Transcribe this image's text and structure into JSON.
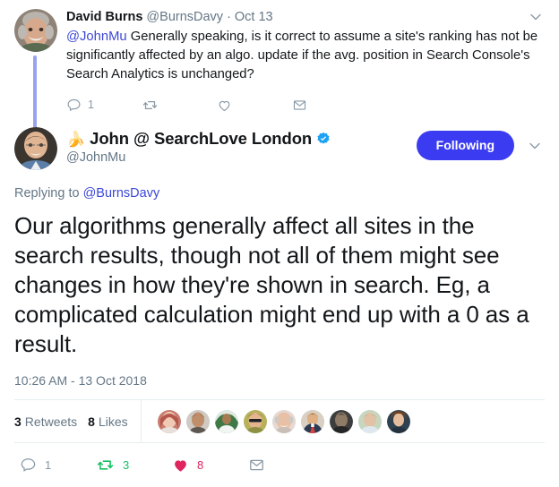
{
  "parent_tweet": {
    "author_name": "David Burns",
    "author_handle": "@BurnsDavy",
    "separator": "·",
    "timestamp": "Oct 13",
    "mention": "@JohnMu",
    "text": " Generally speaking, is it correct to assume a site's ranking has not be significantly affected by an algo. update if the avg. position in Search Console's Search Analytics is unchanged?",
    "actions": {
      "reply_count": "1",
      "retweet_count": "",
      "like_count": "",
      "dm_count": ""
    },
    "caret_icon": "chevron-down-icon"
  },
  "main_tweet": {
    "emoji": "🍌",
    "author_name": "John @ SearchLove London",
    "verified": true,
    "author_handle": "@JohnMu",
    "follow_button_label": "Following",
    "caret_icon": "chevron-down-icon",
    "replying_to_prefix": "Replying to ",
    "replying_to_handle": "@BurnsDavy",
    "text": "Our algorithms generally affect all sites in the search results, though not all of them might see changes in how they're shown in search. Eg, a complicated calculation might end up with a 0 as a result.",
    "timestamp": "10:26 AM - 13 Oct 2018",
    "stats": {
      "retweets_num": "3",
      "retweets_label": "Retweets",
      "likes_num": "8",
      "likes_label": "Likes"
    },
    "actions": {
      "reply_count": "1",
      "retweet_count": "3",
      "like_count": "8",
      "dm_count": ""
    }
  },
  "facepile": [
    {
      "name": "liker-avatar-1"
    },
    {
      "name": "liker-avatar-2"
    },
    {
      "name": "liker-avatar-3"
    },
    {
      "name": "liker-avatar-4"
    },
    {
      "name": "liker-avatar-5"
    },
    {
      "name": "liker-avatar-6"
    },
    {
      "name": "liker-avatar-7"
    },
    {
      "name": "liker-avatar-8"
    },
    {
      "name": "liker-avatar-9"
    }
  ],
  "colors": {
    "link": "#3b47d8",
    "follow_button": "#3b3bf2",
    "thread_line": "#9aa2f0",
    "retweet_green": "#17bf63",
    "like_pink": "#e0245e",
    "muted_text": "#657786",
    "divider": "#e6ecf0",
    "verified_blue": "#1da1f2"
  }
}
